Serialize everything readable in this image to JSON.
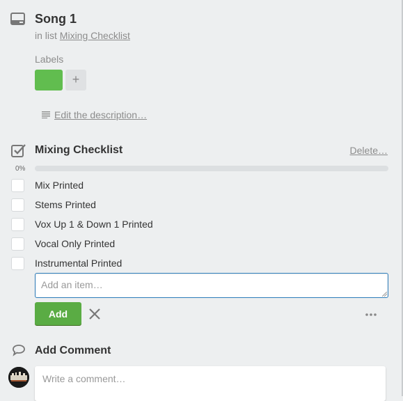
{
  "card": {
    "title": "Song 1",
    "in_list_prefix": "in list",
    "list_name": "Mixing Checklist"
  },
  "labels": {
    "heading": "Labels",
    "items": [
      {
        "color": "#61bd4f",
        "text": ""
      }
    ],
    "add_label": "+"
  },
  "description": {
    "edit_link": "Edit the description…",
    "icon": "description-lines-icon"
  },
  "checklist": {
    "title": "Mixing Checklist",
    "delete_link": "Delete…",
    "progress_text": "0%",
    "progress_fraction": 0,
    "items": [
      {
        "text": "Mix Printed",
        "checked": false
      },
      {
        "text": "Stems Printed",
        "checked": false
      },
      {
        "text": "Vox Up 1 & Down 1 Printed",
        "checked": false
      },
      {
        "text": "Vocal Only Printed",
        "checked": false
      },
      {
        "text": "Instrumental Printed",
        "checked": false
      }
    ],
    "add_item_placeholder": "Add an item…",
    "add_button": "Add"
  },
  "comment": {
    "title": "Add Comment",
    "placeholder": "Write a comment…"
  },
  "colors": {
    "accent_green": "#5aac44",
    "label_green": "#61bd4f",
    "focus_blue": "#2b7bb9",
    "background": "#edeff0"
  }
}
